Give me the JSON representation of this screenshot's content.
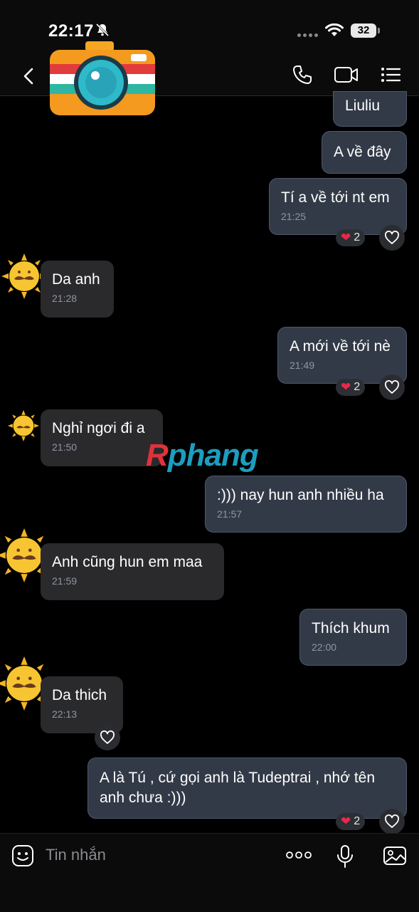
{
  "status": {
    "time": "22:17",
    "battery": "32"
  },
  "header": {
    "logo_icon": "camera-logo-icon"
  },
  "messages": [
    {
      "side": "me",
      "text": "Liuliu",
      "time": ""
    },
    {
      "side": "me",
      "text": "A về đây",
      "time": ""
    },
    {
      "side": "me",
      "text": "Tí a về tới nt em",
      "time": "21:25",
      "reaction_count": "2"
    },
    {
      "side": "them",
      "text": "Da anh",
      "time": "21:28"
    },
    {
      "side": "me",
      "text": "A mới về tới nè",
      "time": "21:49",
      "reaction_count": "2"
    },
    {
      "side": "them",
      "text": "Nghỉ ngơi đi a",
      "time": "21:50"
    },
    {
      "side": "me",
      "text": ":))) nay hun anh nhiều ha",
      "time": "21:57"
    },
    {
      "side": "them",
      "text": "Anh cũng hun em maa",
      "time": "21:59"
    },
    {
      "side": "me",
      "text": "Thích khum",
      "time": "22:00"
    },
    {
      "side": "them",
      "text": "Da thich",
      "time": "22:13"
    },
    {
      "side": "me",
      "text_line1": "A là Tú , cứ gọi anh là Tudeptrai , nhớ tên",
      "text_line2": "anh chưa :)))",
      "reaction_count": "2"
    }
  ],
  "watermark": {
    "part1": "R",
    "part2": "phang"
  },
  "composer": {
    "placeholder": "Tin nhắn"
  },
  "colors": {
    "bubble_me": "#333a47",
    "bubble_them": "#2a2a2c",
    "heart": "#e8294a"
  }
}
